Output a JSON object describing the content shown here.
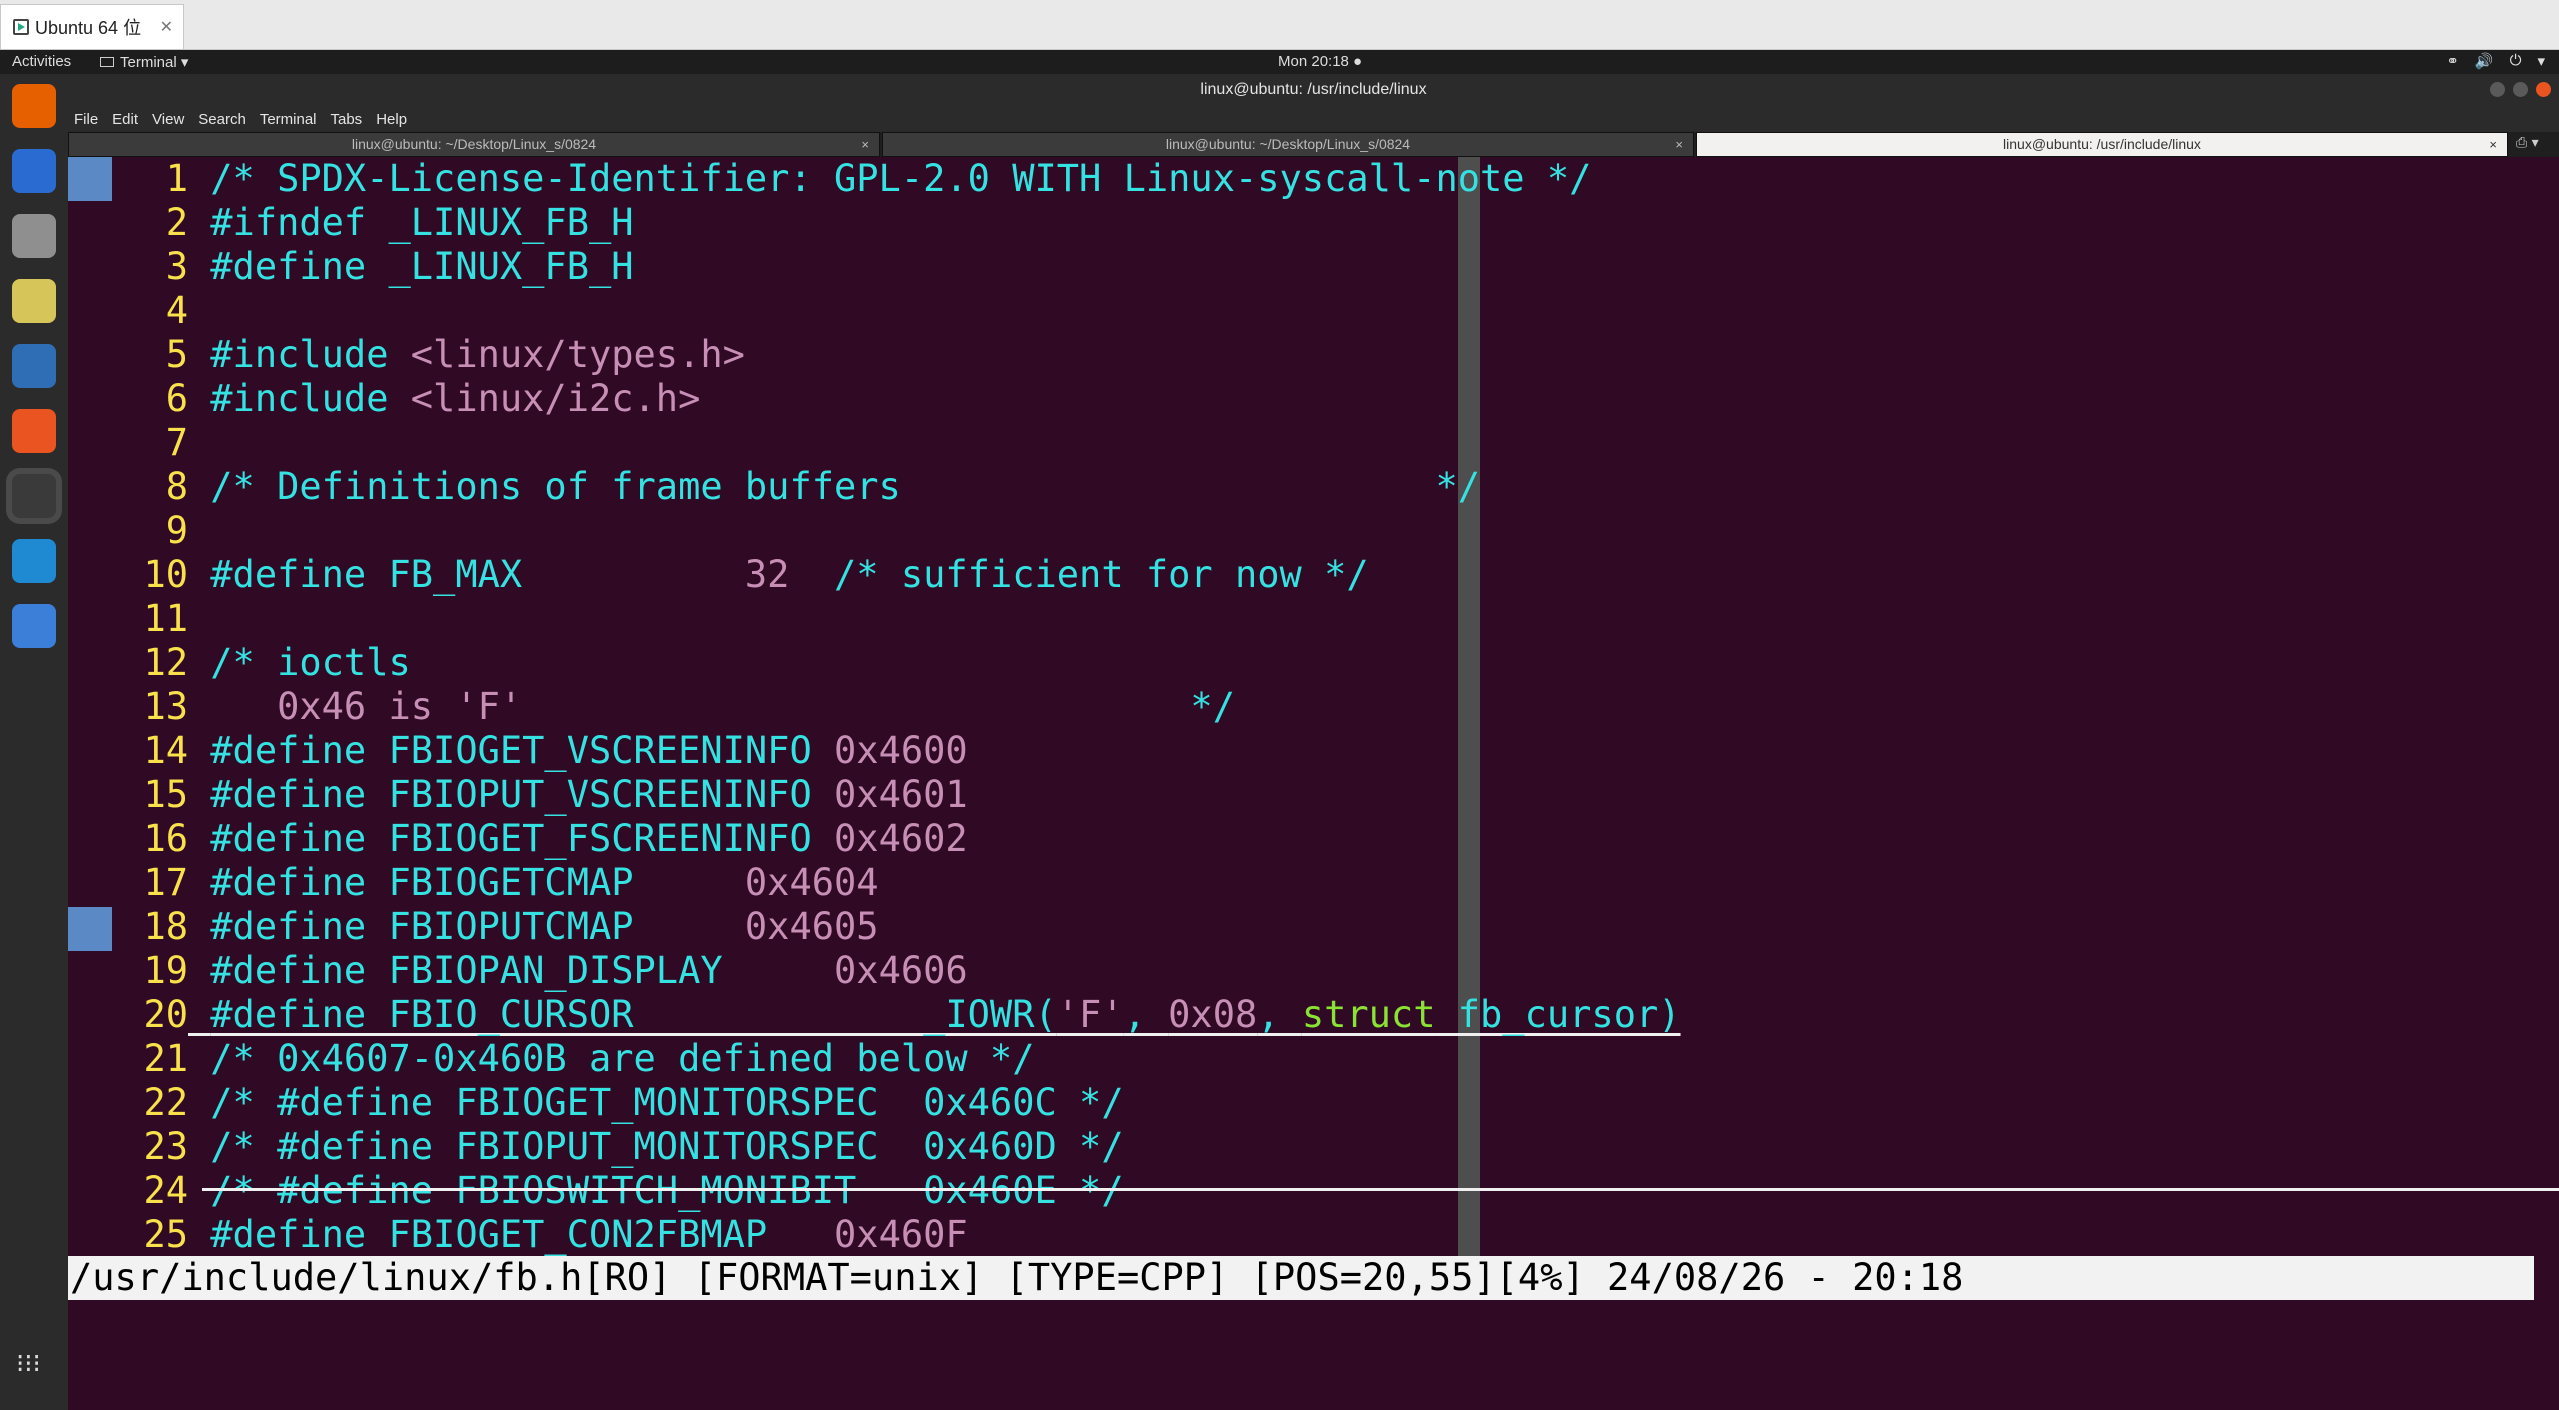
{
  "vm": {
    "tab_title": "Ubuntu 64 位",
    "close": "✕"
  },
  "panel": {
    "activities": "Activities",
    "app_menu": "Terminal ▾",
    "clock": "Mon 20:18 ●",
    "tray": [
      "⚭",
      "🔊",
      "⏻",
      "▾"
    ]
  },
  "window": {
    "title": "linux@ubuntu: /usr/include/linux"
  },
  "menu": [
    "File",
    "Edit",
    "View",
    "Search",
    "Terminal",
    "Tabs",
    "Help"
  ],
  "tabs": [
    {
      "label": "linux@ubuntu: ~/Desktop/Linux_s/0824",
      "close": "×"
    },
    {
      "label": "linux@ubuntu: ~/Desktop/Linux_s/0824",
      "close": "×"
    },
    {
      "label": "linux@ubuntu: /usr/include/linux",
      "close": "×"
    }
  ],
  "tab_button": "⎙ ▾",
  "dock": [
    {
      "name": "firefox-icon",
      "color": "#e66000"
    },
    {
      "name": "thunderbird-icon",
      "color": "#2a6bd1"
    },
    {
      "name": "files-icon",
      "color": "#8f8f8f"
    },
    {
      "name": "rhythmbox-icon",
      "color": "#d6c65a"
    },
    {
      "name": "writer-icon",
      "color": "#2f6db5"
    },
    {
      "name": "software-icon",
      "color": "#e95420"
    },
    {
      "name": "terminal-icon",
      "color": "#3a3a3a"
    },
    {
      "name": "vscode-icon",
      "color": "#1f8ad2"
    },
    {
      "name": "help-icon",
      "color": "#3c7fd8"
    }
  ],
  "apps_grid": "⁝⁝⁝",
  "lines": [
    {
      "n": "1",
      "segs": [
        {
          "c": "cm",
          "t": "/* SPDX-License-Identifier: GPL-2.0 WITH Linux-syscall-note */"
        }
      ]
    },
    {
      "n": "2",
      "segs": [
        {
          "c": "pp",
          "t": "#ifndef _LINUX_FB_H"
        }
      ]
    },
    {
      "n": "3",
      "segs": [
        {
          "c": "pp",
          "t": "#define _LINUX_FB_H"
        }
      ]
    },
    {
      "n": "4",
      "segs": []
    },
    {
      "n": "5",
      "segs": [
        {
          "c": "pp",
          "t": "#include "
        },
        {
          "c": "st",
          "t": "<linux/types.h>"
        }
      ]
    },
    {
      "n": "6",
      "segs": [
        {
          "c": "pp",
          "t": "#include "
        },
        {
          "c": "st",
          "t": "<linux/i2c.h>"
        }
      ]
    },
    {
      "n": "7",
      "segs": []
    },
    {
      "n": "8",
      "segs": [
        {
          "c": "cm",
          "t": "/* Definitions of frame buffers                        */"
        }
      ]
    },
    {
      "n": "9",
      "segs": []
    },
    {
      "n": "10",
      "segs": [
        {
          "c": "pp",
          "t": "#define FB_MAX          "
        },
        {
          "c": "nm",
          "t": "32"
        },
        {
          "c": "cm",
          "t": "  /* sufficient for now */"
        }
      ]
    },
    {
      "n": "11",
      "segs": []
    },
    {
      "n": "12",
      "segs": [
        {
          "c": "cm",
          "t": "/* ioctls"
        }
      ]
    },
    {
      "n": "13",
      "segs": [
        {
          "c": "st",
          "t": "   0x46 is 'F'"
        },
        {
          "c": "cm",
          "t": "                              */"
        }
      ]
    },
    {
      "n": "14",
      "segs": [
        {
          "c": "pp",
          "t": "#define FBIOGET_VSCREENINFO "
        },
        {
          "c": "nm",
          "t": "0x4600"
        }
      ]
    },
    {
      "n": "15",
      "segs": [
        {
          "c": "pp",
          "t": "#define FBIOPUT_VSCREENINFO "
        },
        {
          "c": "nm",
          "t": "0x4601"
        }
      ]
    },
    {
      "n": "16",
      "segs": [
        {
          "c": "pp",
          "t": "#define FBIOGET_FSCREENINFO "
        },
        {
          "c": "nm",
          "t": "0x4602"
        }
      ]
    },
    {
      "n": "17",
      "segs": [
        {
          "c": "pp",
          "t": "#define FBIOGETCMAP     "
        },
        {
          "c": "nm",
          "t": "0x4604"
        }
      ]
    },
    {
      "n": "18",
      "segs": [
        {
          "c": "pp",
          "t": "#define FBIOPUTCMAP     "
        },
        {
          "c": "nm",
          "t": "0x4605"
        }
      ]
    },
    {
      "n": "19",
      "segs": [
        {
          "c": "pp",
          "t": "#define FBIOPAN_DISPLAY     "
        },
        {
          "c": "nm",
          "t": "0x4606"
        }
      ]
    },
    {
      "n": "20",
      "segs": [
        {
          "c": "pp",
          "t": "#define FBIO_CURSOR             _IOWR("
        },
        {
          "c": "st",
          "t": "'F'"
        },
        {
          "c": "pp",
          "t": ", "
        },
        {
          "c": "nm",
          "t": "0x08"
        },
        {
          "c": "pp",
          "t": ", "
        },
        {
          "c": "tp",
          "t": "struct"
        },
        {
          "c": "pp",
          "t": " fb_cursor)"
        }
      ]
    },
    {
      "n": "21",
      "segs": [
        {
          "c": "cm",
          "t": "/* 0x4607-0x460B are defined below */"
        }
      ]
    },
    {
      "n": "22",
      "segs": [
        {
          "c": "cm",
          "t": "/* #define FBIOGET_MONITORSPEC  0x460C */"
        }
      ]
    },
    {
      "n": "23",
      "segs": [
        {
          "c": "cm",
          "t": "/* #define FBIOPUT_MONITORSPEC  0x460D */"
        }
      ]
    },
    {
      "n": "24",
      "segs": [
        {
          "c": "cm",
          "t": "/* #define FBIOSWITCH_MONIBIT   0x460E */"
        }
      ]
    },
    {
      "n": "25",
      "segs": [
        {
          "c": "pp",
          "t": "#define FBIOGET_CON2FBMAP   "
        },
        {
          "c": "nm",
          "t": "0x460F"
        }
      ]
    }
  ],
  "statusline": "/usr/include/linux/fb.h[RO] [FORMAT=unix] [TYPE=CPP] [POS=20,55][4%] 24/08/26 - 20:18"
}
